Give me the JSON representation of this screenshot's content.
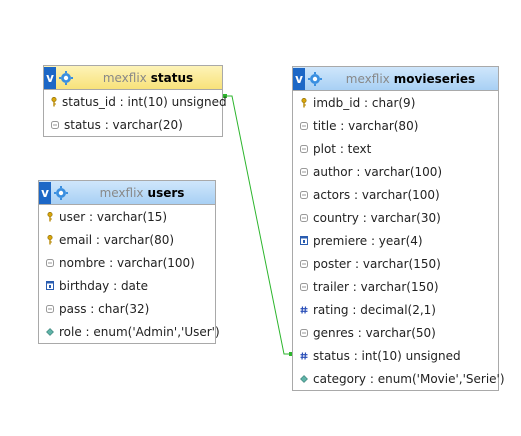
{
  "tables": {
    "status": {
      "db": "mexflix",
      "name": "status",
      "columns": [
        {
          "text": "status_id : int(10) unsigned",
          "icon": "key-icon"
        },
        {
          "text": "status : varchar(20)",
          "icon": "text-field-icon"
        }
      ]
    },
    "users": {
      "db": "mexflix",
      "name": "users",
      "columns": [
        {
          "text": "user : varchar(15)",
          "icon": "key-icon"
        },
        {
          "text": "email : varchar(80)",
          "icon": "key-icon"
        },
        {
          "text": "nombre : varchar(100)",
          "icon": "text-field-icon"
        },
        {
          "text": "birthday : date",
          "icon": "date-field-icon"
        },
        {
          "text": "pass : char(32)",
          "icon": "text-field-icon"
        },
        {
          "text": "role : enum('Admin','User')",
          "icon": "enum-field-icon"
        }
      ]
    },
    "movieseries": {
      "db": "mexflix",
      "name": "movieseries",
      "columns": [
        {
          "text": "imdb_id : char(9)",
          "icon": "key-icon"
        },
        {
          "text": "title : varchar(80)",
          "icon": "text-field-icon"
        },
        {
          "text": "plot : text",
          "icon": "text-field-icon"
        },
        {
          "text": "author : varchar(100)",
          "icon": "text-field-icon"
        },
        {
          "text": "actors : varchar(100)",
          "icon": "text-field-icon"
        },
        {
          "text": "country : varchar(30)",
          "icon": "text-field-icon"
        },
        {
          "text": "premiere : year(4)",
          "icon": "date-field-icon"
        },
        {
          "text": "poster : varchar(150)",
          "icon": "text-field-icon"
        },
        {
          "text": "trailer : varchar(150)",
          "icon": "text-field-icon"
        },
        {
          "text": "rating : decimal(2,1)",
          "icon": "numeric-field-icon"
        },
        {
          "text": "genres : varchar(50)",
          "icon": "text-field-icon"
        },
        {
          "text": "status : int(10) unsigned",
          "icon": "numeric-field-icon"
        },
        {
          "text": "category : enum('Movie','Serie')",
          "icon": "enum-field-icon"
        }
      ]
    }
  },
  "header_button_label": "v",
  "colors": {
    "relation_line": "#2db52d",
    "header_blue": "#a8d0f4",
    "header_yellow": "#f8e27a",
    "toggle_button": "#1c67c6"
  }
}
